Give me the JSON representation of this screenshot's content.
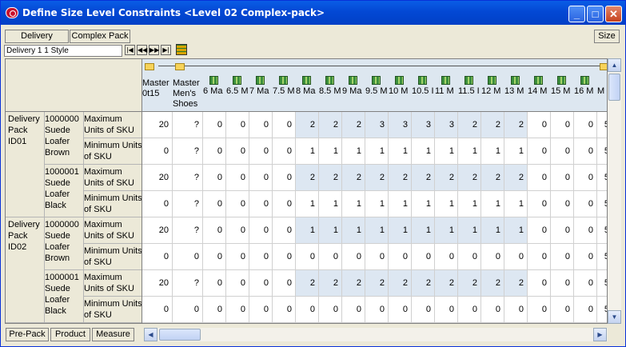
{
  "window": {
    "title": "Define Size Level Constraints <Level 02 Complex-pack>",
    "minimize": "_",
    "maximize": "□",
    "close": "✕"
  },
  "toolbar": {
    "delivery_label": "Delivery",
    "complex_pack_label": "Complex Pack",
    "size_label": "Size"
  },
  "position": {
    "text": "Delivery 1   1 Style"
  },
  "nav": {
    "first": "|◀",
    "prev": "◀◀",
    "next": "▶▶",
    "last": "▶|"
  },
  "columns": [
    {
      "label": "Master\n0t15",
      "icon": "folder-icon"
    },
    {
      "label": "Master\nMen's\nShoes",
      "icon": "folder-icon"
    },
    {
      "label": "6 Ma",
      "icon": "size-cube-icon"
    },
    {
      "label": "6.5 M",
      "icon": "size-cube-icon"
    },
    {
      "label": "7 Ma",
      "icon": "size-cube-icon"
    },
    {
      "label": "7.5 M",
      "icon": "size-cube-icon"
    },
    {
      "label": "8 Ma",
      "icon": "size-cube-icon"
    },
    {
      "label": "8.5 M",
      "icon": "size-cube-icon"
    },
    {
      "label": "9 Ma",
      "icon": "size-cube-icon"
    },
    {
      "label": "9.5 M",
      "icon": "size-cube-icon"
    },
    {
      "label": "10 M",
      "icon": "size-cube-icon"
    },
    {
      "label": "10.5 I",
      "icon": "size-cube-icon"
    },
    {
      "label": "11 M",
      "icon": "size-cube-icon"
    },
    {
      "label": "11.5 I",
      "icon": "size-cube-icon"
    },
    {
      "label": "12 M",
      "icon": "size-cube-icon"
    },
    {
      "label": "13 M",
      "icon": "size-cube-icon"
    },
    {
      "label": "14 M",
      "icon": "size-cube-icon"
    },
    {
      "label": "15 M",
      "icon": "size-cube-icon"
    },
    {
      "label": "16 M",
      "icon": "size-cube-icon"
    },
    {
      "label": "M",
      "icon": "folder-icon"
    }
  ],
  "packs": [
    {
      "label": "Delivery\nPack\nID01",
      "skus": [
        "1000000\nSuede\nLoafer\nBrown",
        "1000001\nSuede\nLoafer\nBlack"
      ]
    },
    {
      "label": "Delivery\nPack\nID02",
      "skus": [
        "1000000\nSuede\nLoafer\nBrown",
        "1000001\nSuede\nLoafer\nBlack"
      ]
    }
  ],
  "measures": {
    "max": "Maximum\nUnits of SKU",
    "min": "Minimum Units\nof SKU"
  },
  "rows": [
    [
      "20",
      "?",
      "0",
      "0",
      "0",
      "0",
      "2",
      "2",
      "2",
      "3",
      "3",
      "3",
      "3",
      "2",
      "2",
      "2",
      "0",
      "0",
      "0",
      "5"
    ],
    [
      "0",
      "?",
      "0",
      "0",
      "0",
      "0",
      "1",
      "1",
      "1",
      "1",
      "1",
      "1",
      "1",
      "1",
      "1",
      "1",
      "0",
      "0",
      "0",
      "5"
    ],
    [
      "20",
      "?",
      "0",
      "0",
      "0",
      "0",
      "2",
      "2",
      "2",
      "2",
      "2",
      "2",
      "2",
      "2",
      "2",
      "2",
      "0",
      "0",
      "0",
      "5"
    ],
    [
      "0",
      "?",
      "0",
      "0",
      "0",
      "0",
      "1",
      "1",
      "1",
      "1",
      "1",
      "1",
      "1",
      "1",
      "1",
      "1",
      "0",
      "0",
      "0",
      "5"
    ],
    [
      "20",
      "?",
      "0",
      "0",
      "0",
      "0",
      "1",
      "1",
      "1",
      "1",
      "1",
      "1",
      "1",
      "1",
      "1",
      "1",
      "0",
      "0",
      "0",
      "5"
    ],
    [
      "0",
      "0",
      "0",
      "0",
      "0",
      "0",
      "0",
      "0",
      "0",
      "0",
      "0",
      "0",
      "0",
      "0",
      "0",
      "0",
      "0",
      "0",
      "0",
      "5"
    ],
    [
      "20",
      "?",
      "0",
      "0",
      "0",
      "0",
      "2",
      "2",
      "2",
      "2",
      "2",
      "2",
      "2",
      "2",
      "2",
      "2",
      "0",
      "0",
      "0",
      "5"
    ],
    [
      "0",
      "0",
      "0",
      "0",
      "0",
      "0",
      "0",
      "0",
      "0",
      "0",
      "0",
      "0",
      "0",
      "0",
      "0",
      "0",
      "0",
      "0",
      "0",
      "5"
    ]
  ],
  "highlight_rows": [
    0,
    2,
    4,
    6
  ],
  "highlight_cols": [
    6,
    7,
    8,
    9,
    10,
    11,
    12,
    13,
    14,
    15
  ],
  "bottom_tabs": {
    "prepack": "Pre-Pack",
    "product": "Product",
    "measure": "Measure"
  },
  "colors": {
    "title_bar": "#0348d4",
    "highlight": "#dde7f2"
  }
}
